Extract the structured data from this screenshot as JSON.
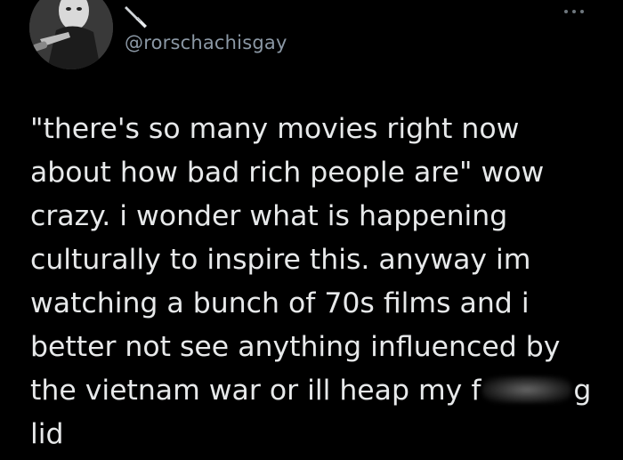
{
  "account": {
    "handle": "@rorschachisgay",
    "name_emoji": "knife-icon",
    "avatar": "masked-figure-avatar"
  },
  "tweet": {
    "lines": [
      "\"there's so many movies right now",
      "about how bad rich people are\" wow",
      "crazy. i wonder what is happening",
      "culturally to inspire this. anyway im",
      "watching a bunch of 70s films and i",
      "better not see anything influenced by"
    ],
    "line7_before_censor": "the vietnam war or ill heap my f",
    "line7_after_censor": "g",
    "line8": "lid"
  },
  "colors": {
    "background": "#000000",
    "text": "#e7e9ea",
    "handle": "#8b98a5",
    "more_dots": "#6e767d"
  },
  "icons": {
    "more": "more-horizontal-icon"
  }
}
